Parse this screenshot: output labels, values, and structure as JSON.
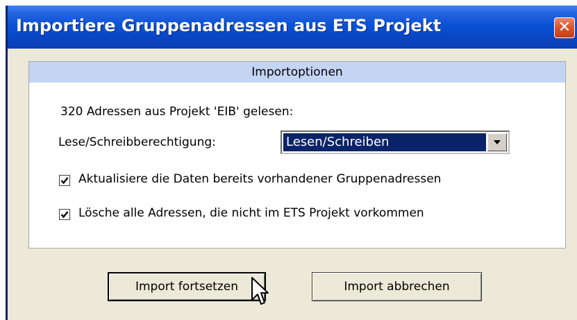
{
  "window": {
    "title": "Importiere Gruppenadressen aus ETS Projekt",
    "close_glyph": "✕"
  },
  "options": {
    "header": "Importoptionen",
    "addresses_read_text": "320 Adressen aus Projekt 'EIB' gelesen:",
    "permission_label": "Lese/Schreibberechtigung:",
    "permission_value": "Lesen/Schreiben",
    "checkboxes": [
      {
        "label": "Aktualisiere die Daten bereits vorhandener Gruppenadressen",
        "checked": true
      },
      {
        "label": "Lösche alle Adressen, die nicht im  ETS Projekt vorkommen",
        "checked": true
      }
    ]
  },
  "buttons": {
    "continue_label": "Import fortsetzen",
    "cancel_label": "Import abbrechen"
  },
  "icons": {
    "close": "close-icon",
    "dropdown": "chevron-down-icon",
    "check": "checkmark-icon",
    "cursor": "mouse-pointer-icon"
  },
  "colors": {
    "titlebar": "#0a52d6",
    "panel_header": "#c4d5f4",
    "dialog_bg": "#ece9d8",
    "selection": "#0a246a",
    "close_button": "#d9542b"
  }
}
